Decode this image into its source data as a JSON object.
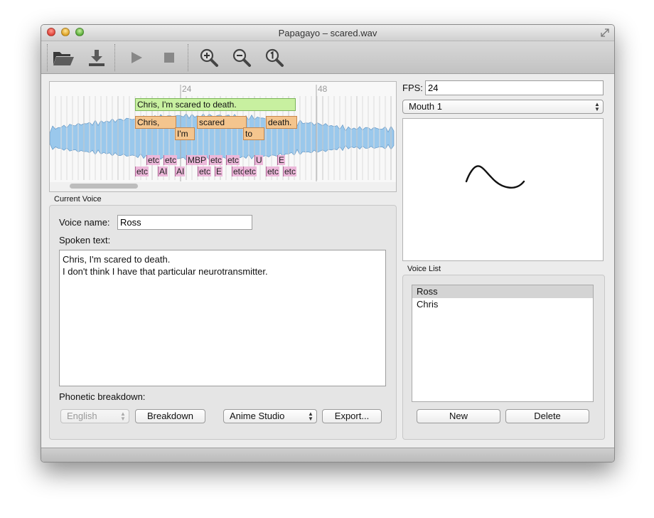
{
  "window": {
    "title": "Papagayo – scared.wav"
  },
  "colors": {
    "waveform": "#9ac8ec",
    "phrase": "#c8f0a0",
    "word": "#f4c58e",
    "phoneme": "#ecb8da"
  },
  "toolbar": {
    "open_icon": "folder-open-icon",
    "save_icon": "download-save-icon",
    "play_icon": "play-icon",
    "stop_icon": "stop-icon",
    "zoom_in_icon": "zoom-in-icon",
    "zoom_out_icon": "zoom-out-icon",
    "zoom_reset_icon": "zoom-1to1-icon"
  },
  "waveform": {
    "frame_markers": [
      "24",
      "48"
    ],
    "phrase": "Chris, I'm scared to death.",
    "words": [
      "Chris,",
      "I'm",
      "scared",
      "to",
      "death."
    ],
    "phonemes_top": [
      "etc",
      "etc",
      "MBP",
      "etc",
      "etc",
      "U",
      "E"
    ],
    "phonemes_bottom": [
      "etc",
      "AI",
      "AI",
      "etc",
      "E",
      "etc",
      "etc",
      "etc",
      "etc"
    ]
  },
  "current_voice": {
    "group_label": "Current Voice",
    "voice_name_label": "Voice name:",
    "voice_name_value": "Ross",
    "spoken_text_label": "Spoken text:",
    "spoken_text_lines": [
      "Chris, I'm scared to death.",
      "I don't think I have that particular neurotransmitter."
    ],
    "phonetic_label": "Phonetic breakdown:",
    "language_value": "English",
    "breakdown_button": "Breakdown",
    "export_format_value": "Anime Studio",
    "export_button": "Export..."
  },
  "side": {
    "fps_label": "FPS:",
    "fps_value": "24",
    "mouth_value": "Mouth 1",
    "voice_list_label": "Voice List",
    "voices": [
      "Ross",
      "Chris"
    ],
    "selected_voice": "Ross",
    "new_button": "New",
    "delete_button": "Delete"
  }
}
